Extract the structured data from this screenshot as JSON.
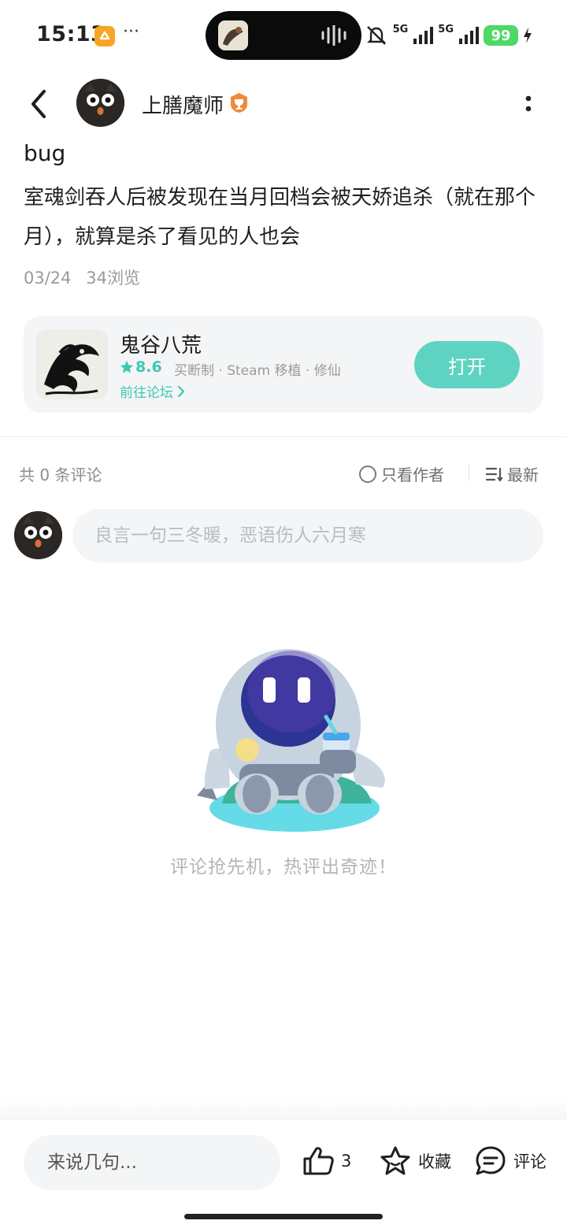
{
  "status_bar": {
    "time": "15:13",
    "dots": "···",
    "net1": "5G",
    "net2": "5G",
    "battery": "99",
    "icons": [
      "app-badge-icon",
      "waveform-icon",
      "mute-bell-icon",
      "signal-icon",
      "charging-icon"
    ]
  },
  "header": {
    "author_name": "上膳魔师",
    "icons": [
      "back-chevron-icon",
      "achievement-badge-icon",
      "more-vertical-icon"
    ]
  },
  "post": {
    "title": "bug",
    "body": "室魂剑吞人后被发现在当月回档会被天娇追杀（就在那个月），就算是杀了看见的人也会",
    "date": "03/24",
    "views": "34浏览"
  },
  "game_card": {
    "name": "鬼谷八荒",
    "rating": "8.6",
    "tags": "买断制 · Steam 移植 · 修仙",
    "forum_link": "前往论坛",
    "open_label": "打开"
  },
  "comments": {
    "count_label": "共 0 条评论",
    "author_only_label": "只看作者",
    "sort_label": "最新",
    "input_placeholder": "良言一句三冬暖，恶语伤人六月寒",
    "empty_text": "评论抢先机，热评出奇迹！"
  },
  "bottom_bar": {
    "input_placeholder": "来说几句...",
    "like_count": "3",
    "favorite_label": "收藏",
    "comment_label": "评论"
  },
  "colors": {
    "accent": "#5ed3c2",
    "accent_text": "#3fc7b4",
    "battery": "#4cd964"
  }
}
